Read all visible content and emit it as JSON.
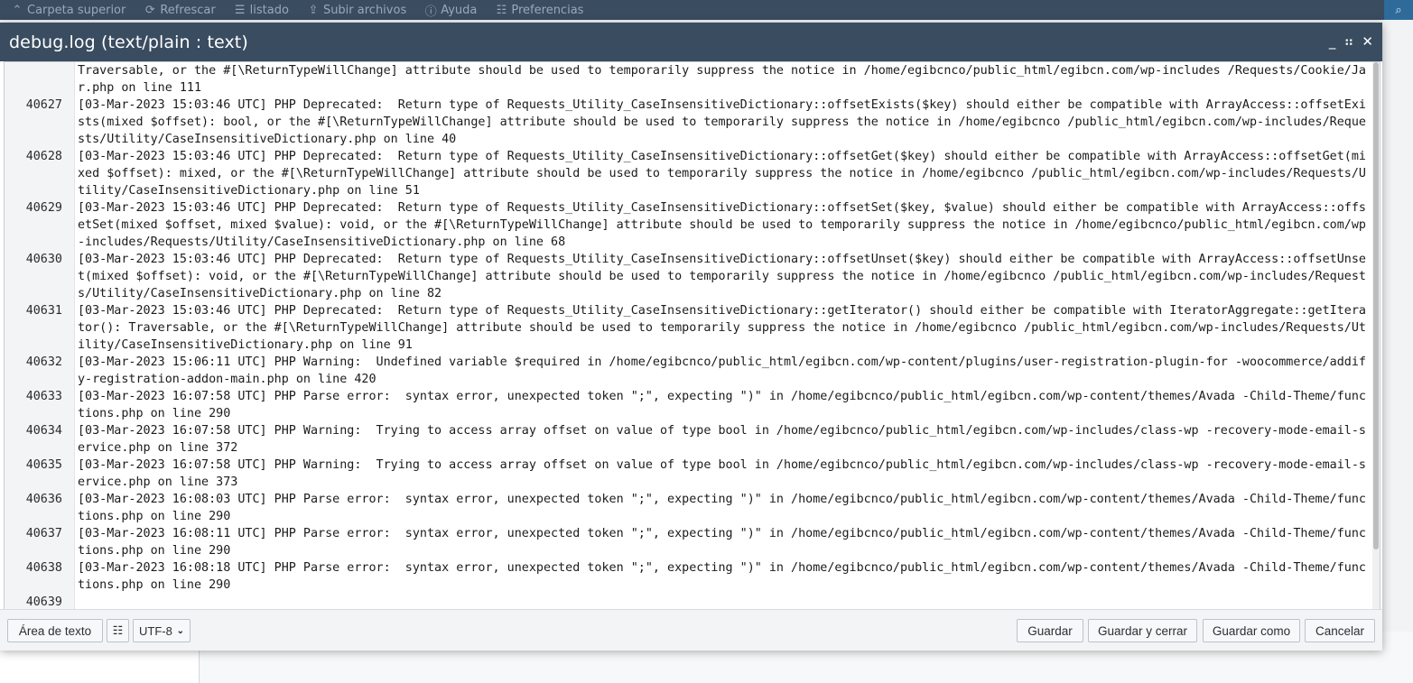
{
  "topbar": {
    "items": [
      {
        "label": "Carpeta superior",
        "icon": "chevron-up-icon"
      },
      {
        "label": "Refrescar",
        "icon": "refresh-icon"
      },
      {
        "label": "listado",
        "icon": "list-icon"
      },
      {
        "label": "Subir archivos",
        "icon": "upload-icon"
      },
      {
        "label": "Ayuda",
        "icon": "help-icon"
      },
      {
        "label": "Preferencias",
        "icon": "sliders-icon"
      }
    ],
    "search_icon": "search-icon"
  },
  "dialog": {
    "title": "debug.log (text/plain : text)",
    "controls": {
      "minimize": "_",
      "maximize": "⠶",
      "close": "✕"
    }
  },
  "editor": {
    "lines": [
      {
        "num": "",
        "text": "Traversable, or the #[\\ReturnTypeWillChange] attribute should be used to temporarily suppress the notice in /home/egibcnco/public_html/egibcn.com/wp-includes /Requests/Cookie/Jar.php on line 111"
      },
      {
        "num": "40627",
        "text": "[03-Mar-2023 15:03:46 UTC] PHP Deprecated:  Return type of Requests_Utility_CaseInsensitiveDictionary::offsetExists($key) should either be compatible with ArrayAccess::offsetExists(mixed $offset): bool, or the #[\\ReturnTypeWillChange] attribute should be used to temporarily suppress the notice in /home/egibcnco /public_html/egibcn.com/wp-includes/Requests/Utility/CaseInsensitiveDictionary.php on line 40"
      },
      {
        "num": "40628",
        "text": "[03-Mar-2023 15:03:46 UTC] PHP Deprecated:  Return type of Requests_Utility_CaseInsensitiveDictionary::offsetGet($key) should either be compatible with ArrayAccess::offsetGet(mixed $offset): mixed, or the #[\\ReturnTypeWillChange] attribute should be used to temporarily suppress the notice in /home/egibcnco /public_html/egibcn.com/wp-includes/Requests/Utility/CaseInsensitiveDictionary.php on line 51"
      },
      {
        "num": "40629",
        "text": "[03-Mar-2023 15:03:46 UTC] PHP Deprecated:  Return type of Requests_Utility_CaseInsensitiveDictionary::offsetSet($key, $value) should either be compatible with ArrayAccess::offsetSet(mixed $offset, mixed $value): void, or the #[\\ReturnTypeWillChange] attribute should be used to temporarily suppress the notice in /home/egibcnco/public_html/egibcn.com/wp-includes/Requests/Utility/CaseInsensitiveDictionary.php on line 68"
      },
      {
        "num": "40630",
        "text": "[03-Mar-2023 15:03:46 UTC] PHP Deprecated:  Return type of Requests_Utility_CaseInsensitiveDictionary::offsetUnset($key) should either be compatible with ArrayAccess::offsetUnset(mixed $offset): void, or the #[\\ReturnTypeWillChange] attribute should be used to temporarily suppress the notice in /home/egibcnco /public_html/egibcn.com/wp-includes/Requests/Utility/CaseInsensitiveDictionary.php on line 82"
      },
      {
        "num": "40631",
        "text": "[03-Mar-2023 15:03:46 UTC] PHP Deprecated:  Return type of Requests_Utility_CaseInsensitiveDictionary::getIterator() should either be compatible with IteratorAggregate::getIterator(): Traversable, or the #[\\ReturnTypeWillChange] attribute should be used to temporarily suppress the notice in /home/egibcnco /public_html/egibcn.com/wp-includes/Requests/Utility/CaseInsensitiveDictionary.php on line 91"
      },
      {
        "num": "40632",
        "text": "[03-Mar-2023 15:06:11 UTC] PHP Warning:  Undefined variable $required in /home/egibcnco/public_html/egibcn.com/wp-content/plugins/user-registration-plugin-for -woocommerce/addify-registration-addon-main.php on line 420"
      },
      {
        "num": "40633",
        "text": "[03-Mar-2023 16:07:58 UTC] PHP Parse error:  syntax error, unexpected token \";\", expecting \")\" in /home/egibcnco/public_html/egibcn.com/wp-content/themes/Avada -Child-Theme/functions.php on line 290"
      },
      {
        "num": "40634",
        "text": "[03-Mar-2023 16:07:58 UTC] PHP Warning:  Trying to access array offset on value of type bool in /home/egibcnco/public_html/egibcn.com/wp-includes/class-wp -recovery-mode-email-service.php on line 372"
      },
      {
        "num": "40635",
        "text": "[03-Mar-2023 16:07:58 UTC] PHP Warning:  Trying to access array offset on value of type bool in /home/egibcnco/public_html/egibcn.com/wp-includes/class-wp -recovery-mode-email-service.php on line 373"
      },
      {
        "num": "40636",
        "text": "[03-Mar-2023 16:08:03 UTC] PHP Parse error:  syntax error, unexpected token \";\", expecting \")\" in /home/egibcnco/public_html/egibcn.com/wp-content/themes/Avada -Child-Theme/functions.php on line 290"
      },
      {
        "num": "40637",
        "text": "[03-Mar-2023 16:08:11 UTC] PHP Parse error:  syntax error, unexpected token \";\", expecting \")\" in /home/egibcnco/public_html/egibcn.com/wp-content/themes/Avada -Child-Theme/functions.php on line 290"
      },
      {
        "num": "40638",
        "text": "[03-Mar-2023 16:08:18 UTC] PHP Parse error:  syntax error, unexpected token \";\", expecting \")\" in /home/egibcnco/public_html/egibcn.com/wp-content/themes/Avada -Child-Theme/functions.php on line 290"
      },
      {
        "num": "40639",
        "text": ""
      }
    ]
  },
  "footer": {
    "textarea_label": "Área de texto",
    "settings_icon": "sliders-icon",
    "encoding": "UTF-8",
    "save": "Guardar",
    "save_close": "Guardar y cerrar",
    "save_as": "Guardar como",
    "cancel": "Cancelar"
  },
  "colors": {
    "header_bg": "#3a4c60",
    "toolbar_text": "#9aa8b7"
  }
}
